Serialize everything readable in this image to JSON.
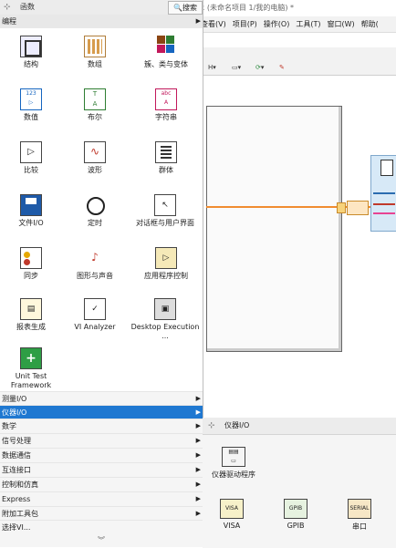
{
  "palette": {
    "title": "函数",
    "search_label": "搜索",
    "header_category": "编程",
    "tiles": [
      {
        "label": "结构",
        "icon": "structures-icon"
      },
      {
        "label": "数组",
        "icon": "array-icon"
      },
      {
        "label": "簇、类与变体",
        "icon": "cluster-class-variant-icon"
      },
      {
        "label": "数值",
        "icon": "numeric-icon"
      },
      {
        "label": "布尔",
        "icon": "boolean-icon"
      },
      {
        "label": "字符串",
        "icon": "string-icon"
      },
      {
        "label": "比较",
        "icon": "comparison-icon"
      },
      {
        "label": "波形",
        "icon": "waveform-icon"
      },
      {
        "label": "群体",
        "icon": "collections-icon"
      },
      {
        "label": "文件I/O",
        "icon": "file-io-icon"
      },
      {
        "label": "定时",
        "icon": "timing-icon"
      },
      {
        "label": "对话框与用户界面",
        "icon": "dialog-ui-icon"
      },
      {
        "label": "同步",
        "icon": "synchronization-icon"
      },
      {
        "label": "图形与声音",
        "icon": "graphics-sound-icon"
      },
      {
        "label": "应用程序控制",
        "icon": "application-control-icon"
      },
      {
        "label": "报表生成",
        "icon": "report-generation-icon"
      },
      {
        "label": "VI Analyzer",
        "icon": "vi-analyzer-icon"
      },
      {
        "label": "Desktop Execution ...",
        "icon": "desktop-execution-icon"
      },
      {
        "label": "Unit Test Framework",
        "icon": "unit-test-framework-icon"
      }
    ],
    "categories": [
      {
        "label": "测量I/O",
        "arrow": true,
        "selected": false
      },
      {
        "label": "仪器I/O",
        "arrow": true,
        "selected": true
      },
      {
        "label": "数学",
        "arrow": true,
        "selected": false
      },
      {
        "label": "信号处理",
        "arrow": true,
        "selected": false
      },
      {
        "label": "数据通信",
        "arrow": true,
        "selected": false
      },
      {
        "label": "互连接口",
        "arrow": true,
        "selected": false
      },
      {
        "label": "控制和仿真",
        "arrow": true,
        "selected": false
      },
      {
        "label": "Express",
        "arrow": true,
        "selected": false
      },
      {
        "label": "附加工具包",
        "arrow": true,
        "selected": false
      },
      {
        "label": "选择VI...",
        "arrow": false,
        "selected": false
      }
    ]
  },
  "subpalette": {
    "title": "仪器I/O",
    "items": [
      {
        "label": "仪器驱动程序",
        "icon": "instrument-drivers-icon"
      },
      {
        "label": "VISA",
        "icon": "visa-icon"
      },
      {
        "label": "GPIB",
        "icon": "gpib-icon"
      },
      {
        "label": "串口",
        "icon": "serial-icon"
      }
    ]
  },
  "background": {
    "title_text": "ε (未命名项目 1/我的电脑) *",
    "menu": [
      "查看(V)",
      "项目(P)",
      "操作(O)",
      "工具(T)",
      "窗口(W)",
      "帮助("
    ],
    "toolbar_text": [
      "[8pt 应用程序字体]",
      "H▾",
      "▾",
      "▾"
    ]
  },
  "colors": {
    "selection": "#1f78d1",
    "wire": "#f08c30",
    "node_blue": "#2b6cb0"
  }
}
